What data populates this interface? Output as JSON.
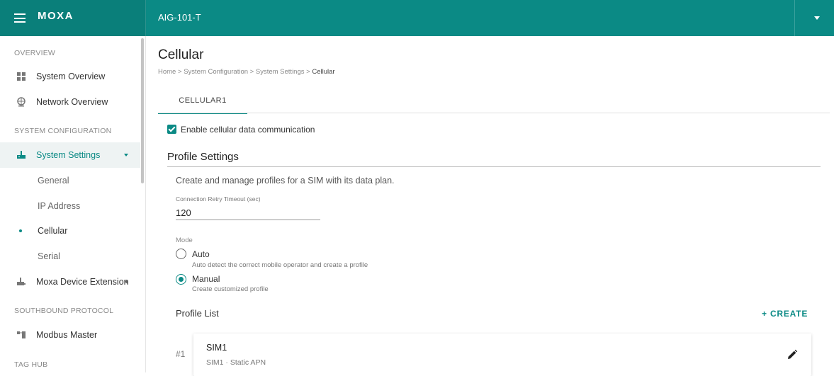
{
  "header": {
    "logo": "MOXA",
    "device_name": "AIG-101-T"
  },
  "sidebar": {
    "sections": [
      "OVERVIEW",
      "SYSTEM CONFIGURATION",
      "SOUTHBOUND PROTOCOL",
      "TAG HUB"
    ],
    "items": [
      {
        "label": "System Overview",
        "icon": "dashboard-icon"
      },
      {
        "label": "Network Overview",
        "icon": "globe-icon"
      },
      {
        "label": "System Settings",
        "icon": "router-icon"
      },
      {
        "label": "General"
      },
      {
        "label": "IP Address"
      },
      {
        "label": "Cellular"
      },
      {
        "label": "Serial"
      },
      {
        "label": "Moxa Device Extension",
        "icon": "device-extension-icon"
      },
      {
        "label": "Modbus Master",
        "icon": "modbus-icon"
      }
    ]
  },
  "main": {
    "title": "Cellular",
    "breadcrumb": {
      "home": "Home",
      "sep": ">",
      "l1": "System Configuration",
      "l2": "System Settings",
      "current": "Cellular"
    },
    "tabs": [
      {
        "label": "CELLULAR1"
      }
    ],
    "enable_label": "Enable cellular data communication",
    "enable_checked": true,
    "profile_settings": {
      "heading": "Profile Settings",
      "description": "Create and manage profiles for a SIM with its data plan.",
      "retry_label": "Connection Retry Timeout (sec)",
      "retry_value": "120",
      "mode_label": "Mode",
      "modes": [
        {
          "label": "Auto",
          "hint": "Auto detect the correct mobile operator and create a profile",
          "selected": false
        },
        {
          "label": "Manual",
          "hint": "Create customized profile",
          "selected": true
        }
      ]
    },
    "profile_list": {
      "heading": "Profile List",
      "create_label": "+ CREATE",
      "profiles": [
        {
          "index": "#1",
          "name": "SIM1",
          "detail": "SIM1 · Static APN"
        }
      ]
    }
  },
  "colors": {
    "accent": "#0b8a85"
  }
}
